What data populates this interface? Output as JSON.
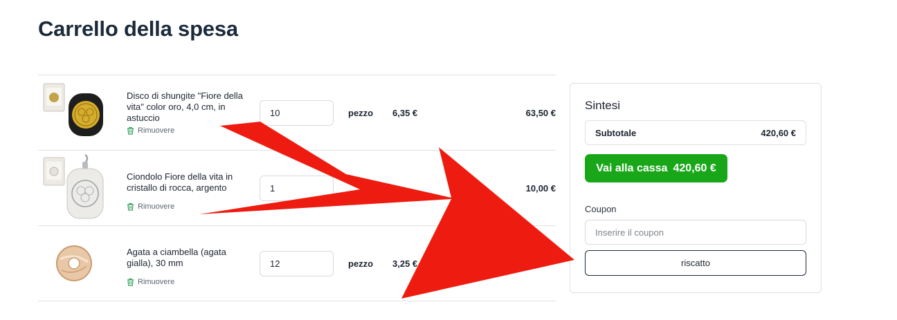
{
  "page": {
    "title": "Carrello della spesa"
  },
  "cart": {
    "items": [
      {
        "name": "Disco di shungite \"Fiore della vita\" color oro, 4,0 cm, in astuccio",
        "remove_label": "Rimuovere",
        "quantity": "10",
        "unit": "pezzo",
        "unit_price": "6,35 €",
        "line_total": "63,50 €"
      },
      {
        "name": "Ciondolo Fiore della vita in cristallo di rocca, argento",
        "remove_label": "Rimuovere",
        "quantity": "1",
        "unit": "",
        "unit_price": "",
        "line_total": "10,00 €"
      },
      {
        "name": "Agata a ciambella (agata gialla), 30 mm",
        "remove_label": "Rimuovere",
        "quantity": "12",
        "unit": "pezzo",
        "unit_price": "3,25 €",
        "line_total": ""
      }
    ]
  },
  "summary": {
    "title": "Sintesi",
    "subtotal_label": "Subtotale",
    "subtotal_value": "420,60 €",
    "checkout_label": "Vai alla cassa",
    "checkout_amount": "420,60 €",
    "coupon_label": "Coupon",
    "coupon_placeholder": "Inserire il coupon",
    "redeem_label": "riscatto"
  },
  "colors": {
    "checkout_green": "#19a719",
    "arrow_red": "#ee1c10",
    "remove_icon_green": "#2e9e5b"
  }
}
